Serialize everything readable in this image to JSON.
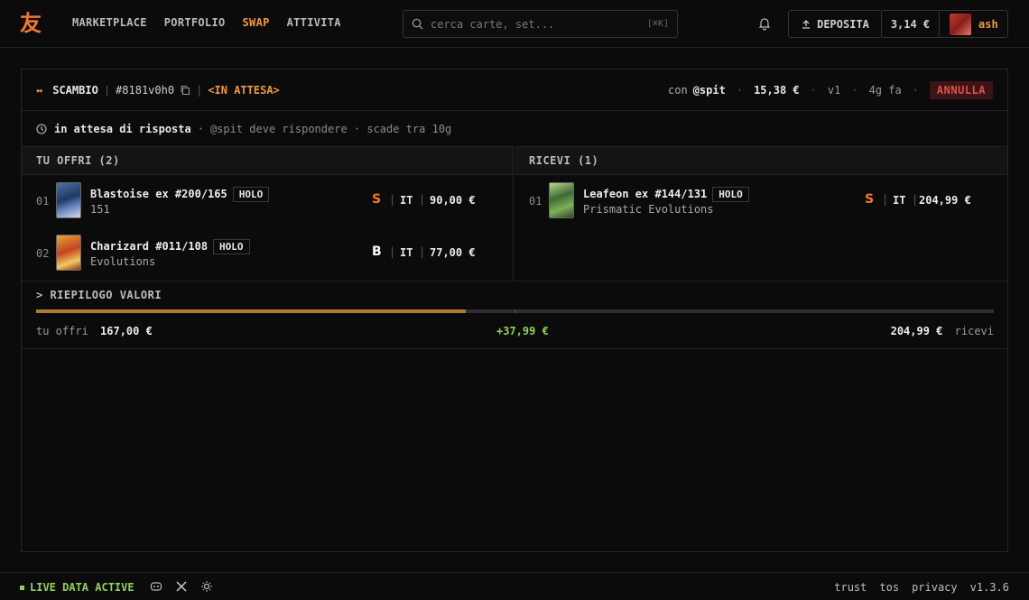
{
  "nav": {
    "logo": "友",
    "links": [
      {
        "label": "MARKETPLACE",
        "active": false
      },
      {
        "label": "PORTFOLIO",
        "active": false
      },
      {
        "label": "SWAP",
        "active": true
      },
      {
        "label": "ATTIVITA",
        "active": false
      }
    ],
    "search_placeholder": "cerca carte, set...",
    "search_shortcut": "[⌘K]",
    "deposit_label": "DEPOSITA",
    "balance": "3,14 €",
    "username": "ash"
  },
  "trade": {
    "icon": "↔",
    "title": "SCAMBIO",
    "id": "#8181v0h0",
    "status": "<IN ATTESA>",
    "with_label": "con",
    "counterparty": "@spit",
    "difference": "15,38 €",
    "version": "v1",
    "age": "4g fa",
    "cancel_label": "ANNULLA",
    "substatus": "in attesa di risposta",
    "subnote": "@spit deve rispondere · scade tra 10g"
  },
  "offer": {
    "header": "TU OFFRI (2)",
    "items": [
      {
        "idx": "01",
        "name": "Blastoise ex #200/165",
        "badge": "HOLO",
        "set": "151",
        "condition": "S",
        "condition_color": "#f07a2a",
        "lang": "IT",
        "price": "90,00 €"
      },
      {
        "idx": "02",
        "name": "Charizard #011/108",
        "badge": "HOLO",
        "set": "Evolutions",
        "condition": "B",
        "condition_color": "#ffffff",
        "lang": "IT",
        "price": "77,00 €"
      }
    ]
  },
  "receive": {
    "header": "RICEVI (1)",
    "items": [
      {
        "idx": "01",
        "name": "Leafeon ex #144/131",
        "badge": "HOLO",
        "set": "Prismatic Evolutions",
        "condition": "S",
        "condition_color": "#f07a2a",
        "lang": "IT",
        "price": "204,99 €"
      }
    ]
  },
  "summary": {
    "header": "> RIEPILOGO VALORI",
    "offer_label": "tu offri",
    "offer_value": "167,00 €",
    "diff": "+37,99 €",
    "receive_value": "204,99 €",
    "receive_label": "ricevi",
    "offer_share": 0.449
  },
  "footer": {
    "live": "LIVE DATA ACTIVE",
    "links": [
      "trust",
      "tos",
      "privacy"
    ],
    "version": "v1.3.6"
  }
}
